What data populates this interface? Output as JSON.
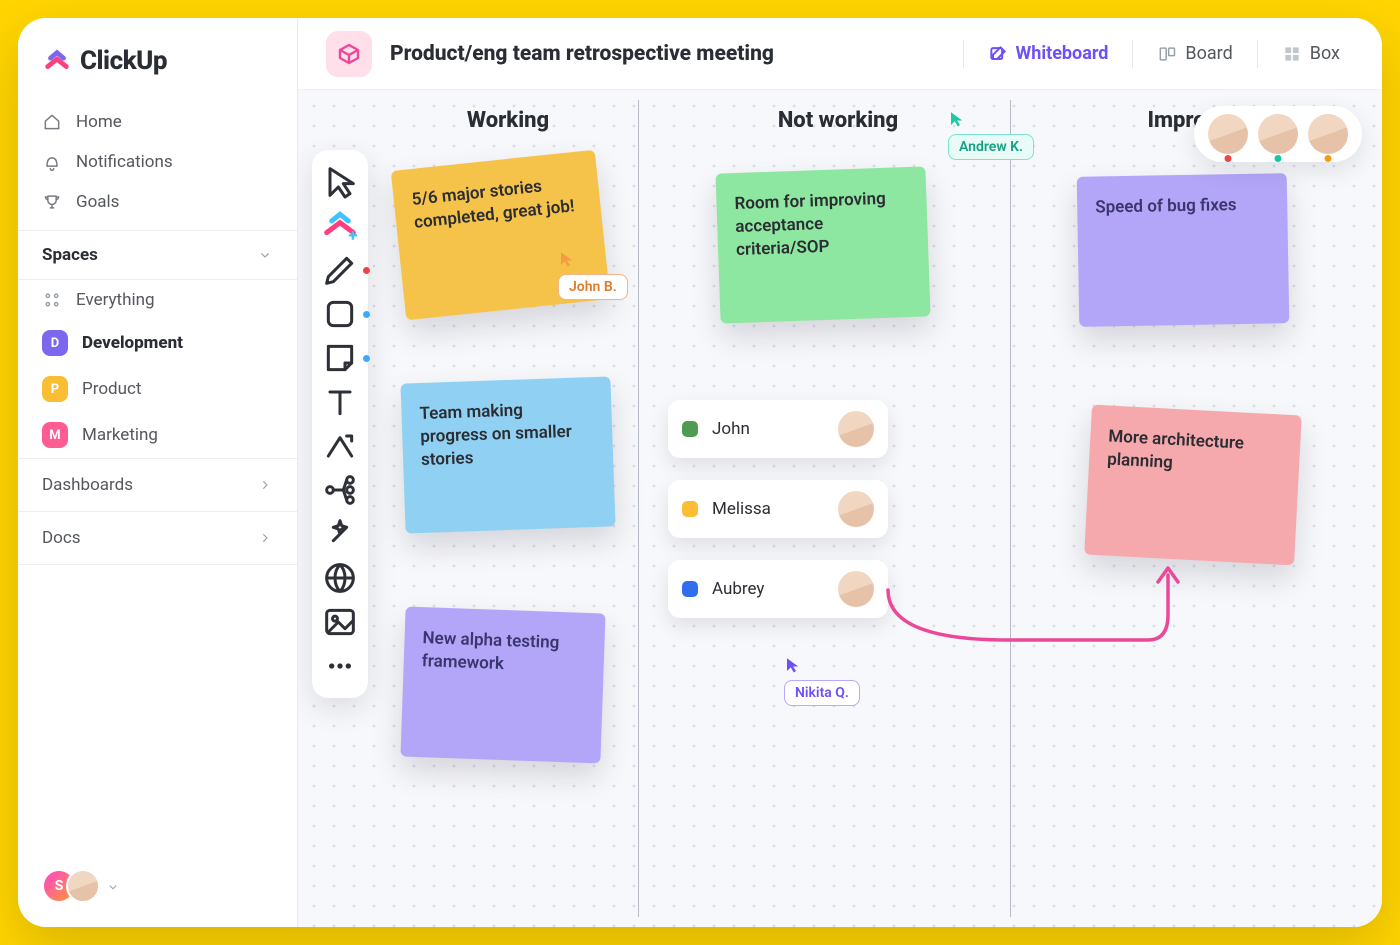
{
  "brand": {
    "name": "ClickUp"
  },
  "nav": {
    "home": "Home",
    "notifications": "Notifications",
    "goals": "Goals"
  },
  "spaces": {
    "heading": "Spaces",
    "everything": "Everything",
    "items": [
      {
        "letter": "D",
        "label": "Development",
        "bg": "#7b68ee"
      },
      {
        "letter": "P",
        "label": "Product",
        "bg": "#f9be34"
      },
      {
        "letter": "M",
        "label": "Marketing",
        "bg": "#ff5c93"
      }
    ]
  },
  "dashboards": "Dashboards",
  "docs": "Docs",
  "user_cluster": {
    "initial": "S",
    "bg1": "linear-gradient(135deg,#ff44cc,#ff9933)"
  },
  "header": {
    "title": "Product/eng team retrospective meeting",
    "tabs": {
      "whiteboard": "Whiteboard",
      "board": "Board",
      "box": "Box"
    }
  },
  "columns": {
    "working": "Working",
    "notworking": "Not working",
    "improve": "Improve"
  },
  "stickies": {
    "s1": "5/6 major stories completed, great job!",
    "s2": "Team making progress on smaller stories",
    "s3": "New alpha testing framework",
    "s4": "Room for improving acceptance criteria/SOP",
    "s5": "Speed of bug fixes",
    "s6": "More architecture planning"
  },
  "people": [
    {
      "name": "John",
      "color": "#4f9b52"
    },
    {
      "name": "Melissa",
      "color": "#f9be34"
    },
    {
      "name": "Aubrey",
      "color": "#2f6fed"
    }
  ],
  "cursors": {
    "john": {
      "label": "John B.",
      "color": "#f59c42"
    },
    "andrew": {
      "label": "Andrew K.",
      "color": "#1ec8a5"
    },
    "nikita": {
      "label": "Nikita Q.",
      "color": "#6f4ff7"
    }
  },
  "presence_colors": [
    "#ef4444",
    "#14c7a3",
    "#f59e0b"
  ]
}
